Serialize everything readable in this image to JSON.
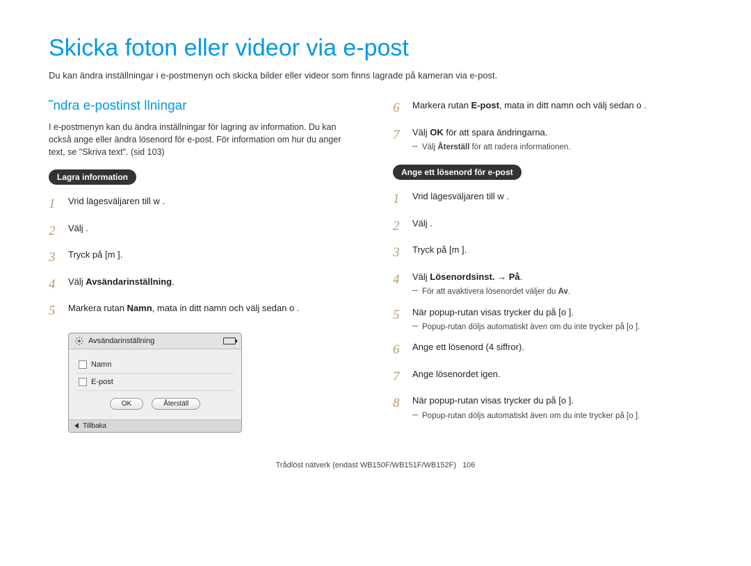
{
  "title": "Skicka foton eller videor via e-post",
  "intro": "Du kan ändra inställningar i e-postmenyn och skicka bilder eller videor som finns lagrade på kameran via e-post.",
  "left": {
    "subhead": "˜ndra e-postinst llningar",
    "para": "I e-postmenyn kan du ändra inställningar för lagring av information. Du kan också ange eller ändra lösenord för e-post. För information om hur du anger text, se \"Skriva text\". (sid 103)",
    "pill": "Lagra information",
    "step1_num": "1",
    "step1": "Vrid lägesväljaren till w      .",
    "step2_num": "2",
    "step2": "Välj      .",
    "step3_num": "3",
    "step3": "Tryck på [m       ].",
    "step4_num": "4",
    "step4_pre": "Välj ",
    "step4_bold": "Avsändarinställning",
    "step4_post": ".",
    "step5_num": "5",
    "step5_pre": "Markera rutan ",
    "step5_bold": "Namn",
    "step5_post": ", mata in ditt namn och välj sedan o     ."
  },
  "device": {
    "header": "Avsändarinställning",
    "row_name": "Namn",
    "row_email": "E-post",
    "btn_ok": "OK",
    "btn_reset": "Återställ",
    "back": "Tillbaka"
  },
  "right": {
    "step6_num": "6",
    "step6_pre": "Markera rutan ",
    "step6_bold": "E-post",
    "step6_post": ", mata in ditt namn och välj sedan o     .",
    "step7_num": "7",
    "step7_pre": "Välj ",
    "step7_bold": "OK",
    "step7_post": " för att spara ändringarna.",
    "step7_note_pre": "Välj ",
    "step7_note_bold": "Återställ",
    "step7_note_post": " för att radera informationen.",
    "pill": "Ange ett lösenord för e-post",
    "pstep1_num": "1",
    "pstep1": "Vrid lägesväljaren till w      .",
    "pstep2_num": "2",
    "pstep2": "Välj      .",
    "pstep3_num": "3",
    "pstep3": "Tryck på [m       ].",
    "pstep4_num": "4",
    "pstep4_pre": "Välj ",
    "pstep4_bold": "Lösenordsinst.",
    "pstep4_arrow": " → ",
    "pstep4_bold2": "På",
    "pstep4_post": ".",
    "pstep4_note_pre": "För att avaktivera lösenordet väljer du ",
    "pstep4_note_bold": "Av",
    "pstep4_note_post": ".",
    "pstep5_num": "5",
    "pstep5": "När popup-rutan visas trycker du på [o     ].",
    "pstep5_note": "Popup-rutan döljs automatiskt även om du inte trycker på [o     ].",
    "pstep6_num": "6",
    "pstep6": "Ange ett lösenord (4 siffror).",
    "pstep7_num": "7",
    "pstep7": "Ange lösenordet igen.",
    "pstep8_num": "8",
    "pstep8": "När popup-rutan visas trycker du på [o     ].",
    "pstep8_note": "Popup-rutan döljs automatiskt även om du inte trycker på [o     ]."
  },
  "footer": {
    "text": "Trådlöst nätverk (endast WB150F/WB151F/WB152F)",
    "page": "106"
  }
}
